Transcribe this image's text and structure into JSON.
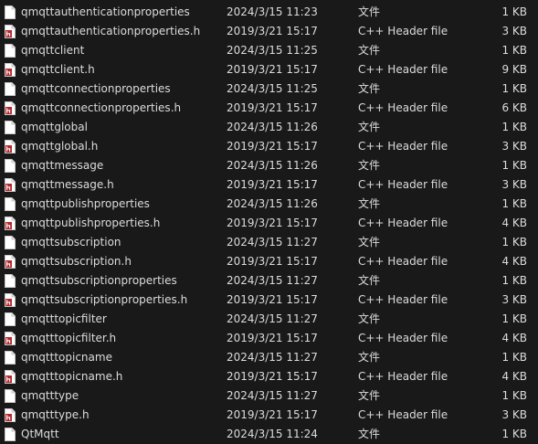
{
  "files": [
    {
      "name": "qmqttauthenticationproperties",
      "date": "2024/3/15 11:23",
      "type": "文件",
      "size": "1 KB",
      "icon": "blank-file-icon"
    },
    {
      "name": "qmqttauthenticationproperties.h",
      "date": "2019/3/21 15:17",
      "type": "C++ Header file",
      "size": "3 KB",
      "icon": "header-file-icon"
    },
    {
      "name": "qmqttclient",
      "date": "2024/3/15 11:25",
      "type": "文件",
      "size": "1 KB",
      "icon": "blank-file-icon"
    },
    {
      "name": "qmqttclient.h",
      "date": "2019/3/21 15:17",
      "type": "C++ Header file",
      "size": "9 KB",
      "icon": "header-file-icon"
    },
    {
      "name": "qmqttconnectionproperties",
      "date": "2024/3/15 11:25",
      "type": "文件",
      "size": "1 KB",
      "icon": "blank-file-icon"
    },
    {
      "name": "qmqttconnectionproperties.h",
      "date": "2019/3/21 15:17",
      "type": "C++ Header file",
      "size": "6 KB",
      "icon": "header-file-icon"
    },
    {
      "name": "qmqttglobal",
      "date": "2024/3/15 11:26",
      "type": "文件",
      "size": "1 KB",
      "icon": "blank-file-icon"
    },
    {
      "name": "qmqttglobal.h",
      "date": "2019/3/21 15:17",
      "type": "C++ Header file",
      "size": "3 KB",
      "icon": "header-file-icon"
    },
    {
      "name": "qmqttmessage",
      "date": "2024/3/15 11:26",
      "type": "文件",
      "size": "1 KB",
      "icon": "blank-file-icon"
    },
    {
      "name": "qmqttmessage.h",
      "date": "2019/3/21 15:17",
      "type": "C++ Header file",
      "size": "3 KB",
      "icon": "header-file-icon"
    },
    {
      "name": "qmqttpublishproperties",
      "date": "2024/3/15 11:26",
      "type": "文件",
      "size": "1 KB",
      "icon": "blank-file-icon"
    },
    {
      "name": "qmqttpublishproperties.h",
      "date": "2019/3/21 15:17",
      "type": "C++ Header file",
      "size": "4 KB",
      "icon": "header-file-icon"
    },
    {
      "name": "qmqttsubscription",
      "date": "2024/3/15 11:27",
      "type": "文件",
      "size": "1 KB",
      "icon": "blank-file-icon"
    },
    {
      "name": "qmqttsubscription.h",
      "date": "2019/3/21 15:17",
      "type": "C++ Header file",
      "size": "4 KB",
      "icon": "header-file-icon"
    },
    {
      "name": "qmqttsubscriptionproperties",
      "date": "2024/3/15 11:27",
      "type": "文件",
      "size": "1 KB",
      "icon": "blank-file-icon"
    },
    {
      "name": "qmqttsubscriptionproperties.h",
      "date": "2019/3/21 15:17",
      "type": "C++ Header file",
      "size": "3 KB",
      "icon": "header-file-icon"
    },
    {
      "name": "qmqtttopicfilter",
      "date": "2024/3/15 11:27",
      "type": "文件",
      "size": "1 KB",
      "icon": "blank-file-icon"
    },
    {
      "name": "qmqtttopicfilter.h",
      "date": "2019/3/21 15:17",
      "type": "C++ Header file",
      "size": "4 KB",
      "icon": "header-file-icon"
    },
    {
      "name": "qmqtttopicname",
      "date": "2024/3/15 11:27",
      "type": "文件",
      "size": "1 KB",
      "icon": "blank-file-icon"
    },
    {
      "name": "qmqtttopicname.h",
      "date": "2019/3/21 15:17",
      "type": "C++ Header file",
      "size": "4 KB",
      "icon": "header-file-icon"
    },
    {
      "name": "qmqtttype",
      "date": "2024/3/15 11:27",
      "type": "文件",
      "size": "1 KB",
      "icon": "blank-file-icon"
    },
    {
      "name": "qmqtttype.h",
      "date": "2019/3/21 15:17",
      "type": "C++ Header file",
      "size": "3 KB",
      "icon": "header-file-icon"
    },
    {
      "name": "QtMqtt",
      "date": "2024/3/15 11:24",
      "type": "文件",
      "size": "1 KB",
      "icon": "blank-file-icon"
    }
  ],
  "colors": {
    "background": "#191919",
    "text": "#dcdcdc",
    "header_badge": "#b5282d"
  }
}
